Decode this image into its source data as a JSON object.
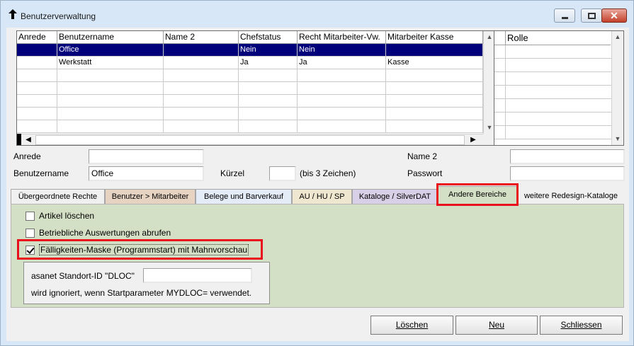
{
  "window": {
    "title": "Benutzerverwaltung"
  },
  "grid": {
    "columns": [
      "Anrede",
      "Benutzername",
      "Name 2",
      "Chefstatus",
      "Recht Mitarbeiter-Vw.",
      "Mitarbeiter Kasse"
    ],
    "rows": [
      {
        "selected": true,
        "cells": [
          "",
          "Office",
          "",
          "Nein",
          "Nein",
          ""
        ]
      },
      {
        "selected": false,
        "cells": [
          "",
          "Werkstatt",
          "",
          "Ja",
          "Ja",
          "Kasse"
        ]
      }
    ]
  },
  "roles": {
    "header": "Rolle"
  },
  "form": {
    "anrede_label": "Anrede",
    "anrede_value": "",
    "name2_label": "Name 2",
    "name2_value": "",
    "benutzername_label": "Benutzername",
    "benutzername_value": "Office",
    "kuerzel_label": "Kürzel",
    "kuerzel_value": "",
    "kuerzel_hint": "(bis 3 Zeichen)",
    "passwort_label": "Passwort",
    "passwort_value": ""
  },
  "tabs": [
    {
      "label": "Übergeordnete Rechte",
      "color": "#f0f0f0"
    },
    {
      "label": "Benutzer > Mitarbeiter",
      "color": "#e6d3c2"
    },
    {
      "label": "Belege und Barverkauf",
      "color": "#e4ecf7"
    },
    {
      "label": "AU / HU / SP",
      "color": "#efe7cf"
    },
    {
      "label": "Kataloge / SilverDAT",
      "color": "#d8d0e6"
    },
    {
      "label": "Andere Bereiche",
      "color": "#d4e0c6",
      "active": true
    },
    {
      "label": "weitere Redesign-Kataloge",
      "color": "#f0f0f0"
    }
  ],
  "panel": {
    "checkboxes": [
      {
        "label": "Artikel löschen",
        "checked": false
      },
      {
        "label": "Betriebliche Auswertungen abrufen",
        "checked": false
      },
      {
        "label": "Fälligkeiten-Maske (Programmstart) mit Mahnvorschau",
        "checked": true
      }
    ],
    "standort_label": "asanet Standort-ID \"DLOC\"",
    "standort_value": "",
    "standort_note": "wird ignoriert, wenn Startparameter MYDLOC= verwendet."
  },
  "buttons": {
    "delete_label": "Löschen",
    "new_label": "Neu",
    "close_label": "Schliessen"
  },
  "colors": {
    "selection": "#00007b",
    "highlight": "#e8101a",
    "panel": "#d4e0c6"
  }
}
